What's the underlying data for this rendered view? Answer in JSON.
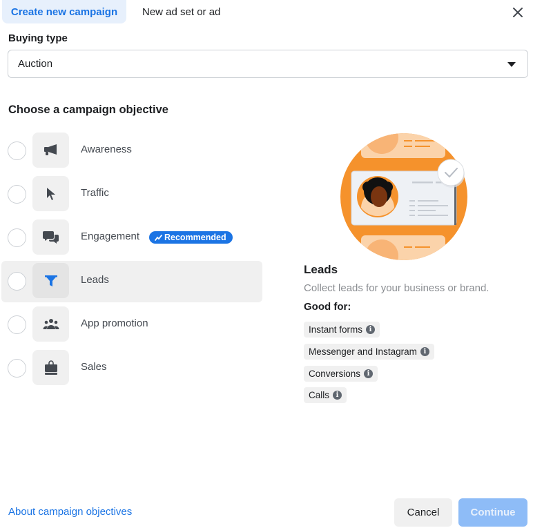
{
  "header": {
    "tabs": [
      {
        "label": "Create new campaign",
        "active": true
      },
      {
        "label": "New ad set or ad",
        "active": false
      }
    ],
    "close_icon": "close-icon"
  },
  "buying_type": {
    "label": "Buying type",
    "value": "Auction",
    "icon": "caret-down-icon"
  },
  "objectives": {
    "title": "Choose a campaign objective",
    "items": [
      {
        "label": "Awareness",
        "icon": "megaphone-icon",
        "selected": false
      },
      {
        "label": "Traffic",
        "icon": "cursor-icon",
        "selected": false
      },
      {
        "label": "Engagement",
        "icon": "chat-bubbles-icon",
        "selected": false,
        "badge": "Recommended"
      },
      {
        "label": "Leads",
        "icon": "funnel-icon",
        "selected": true
      },
      {
        "label": "App promotion",
        "icon": "people-icon",
        "selected": false
      },
      {
        "label": "Sales",
        "icon": "shopping-bag-icon",
        "selected": false
      }
    ]
  },
  "detail": {
    "title": "Leads",
    "description": "Collect leads for your business or brand.",
    "good_for_label": "Good for:",
    "chips": [
      {
        "label": "Instant forms",
        "info_icon": "i"
      },
      {
        "label": "Messenger and Instagram",
        "info_icon": "i"
      },
      {
        "label": "Conversions",
        "info_icon": "i"
      },
      {
        "label": "Calls",
        "info_icon": "i"
      }
    ]
  },
  "footer": {
    "link": "About campaign objectives",
    "cancel": "Cancel",
    "continue": "Continue"
  },
  "colors": {
    "accent": "#1b74e4",
    "illustration_orange": "#f5922c",
    "continue_disabled": "#8ebcf7"
  }
}
